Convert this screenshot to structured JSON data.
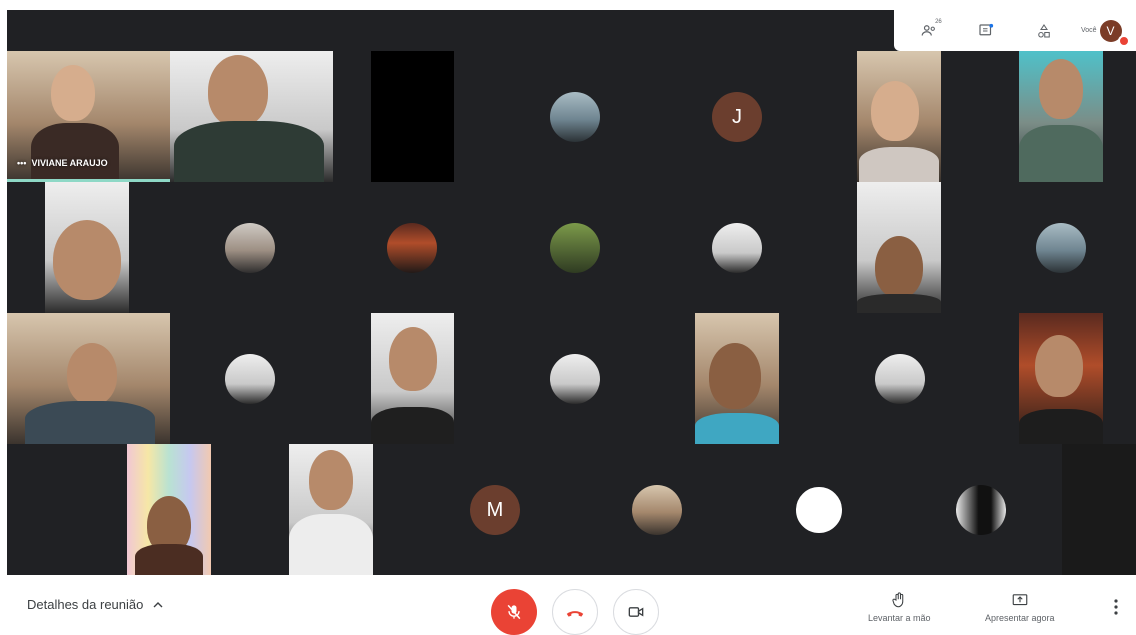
{
  "topbar": {
    "participant_count": "26",
    "you_label": "Você",
    "you_avatar_letter": "V"
  },
  "grid": {
    "active_speaker_name": "VIVIANE ARAUJO",
    "letter_tiles": [
      "J",
      "M"
    ]
  },
  "bottombar": {
    "meeting_details_label": "Detalhes da reunião",
    "raise_hand_label": "Levantar a mão",
    "present_now_label": "Apresentar agora"
  },
  "colors": {
    "grid_background": "#202124",
    "mic_off_red": "#ea4335",
    "speaking_indicator": "#8ed8c6"
  },
  "icons": [
    "people-icon",
    "chat-icon",
    "activities-icon",
    "mic-off-icon",
    "hang-up-icon",
    "camera-icon",
    "hand-icon",
    "present-icon",
    "more-vert-icon",
    "chevron-up-icon"
  ]
}
